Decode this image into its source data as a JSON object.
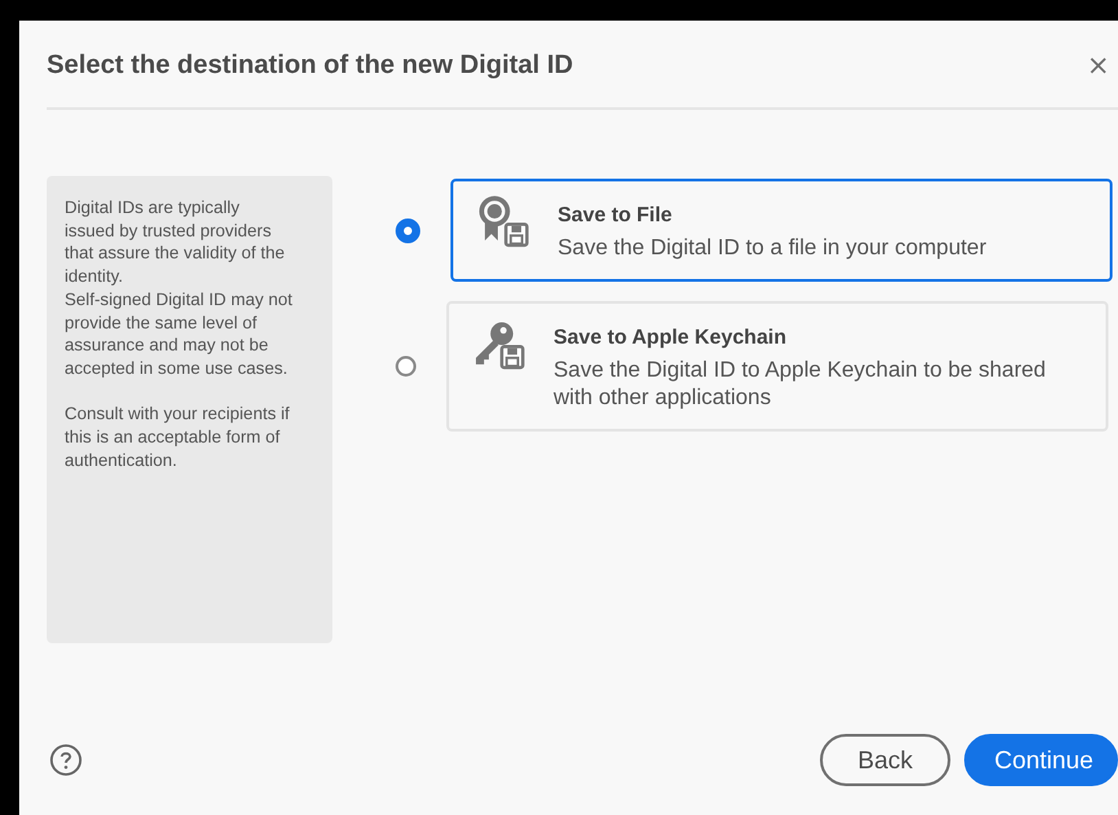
{
  "dialog": {
    "title": "Select the destination of the new Digital ID",
    "close": "×"
  },
  "info": "Digital IDs are typically issued by trusted providers that assure the validity of the identity.\nSelf-signed Digital ID may not provide the same level of assurance and may not be accepted in some use cases.\n\nConsult with your recipients if this is an acceptable form of authentication.",
  "options": [
    {
      "kind": "file",
      "title": "Save to File",
      "description": "Save the Digital ID to a file in your computer",
      "selected": true
    },
    {
      "kind": "keychain",
      "title": "Save to Apple Keychain",
      "description": "Save the Digital ID to Apple Keychain to be shared with other applications",
      "selected": false
    }
  ],
  "buttons": [
    {
      "kind": "secondary",
      "label": "Back"
    },
    {
      "kind": "primary",
      "label": "Continue"
    }
  ]
}
